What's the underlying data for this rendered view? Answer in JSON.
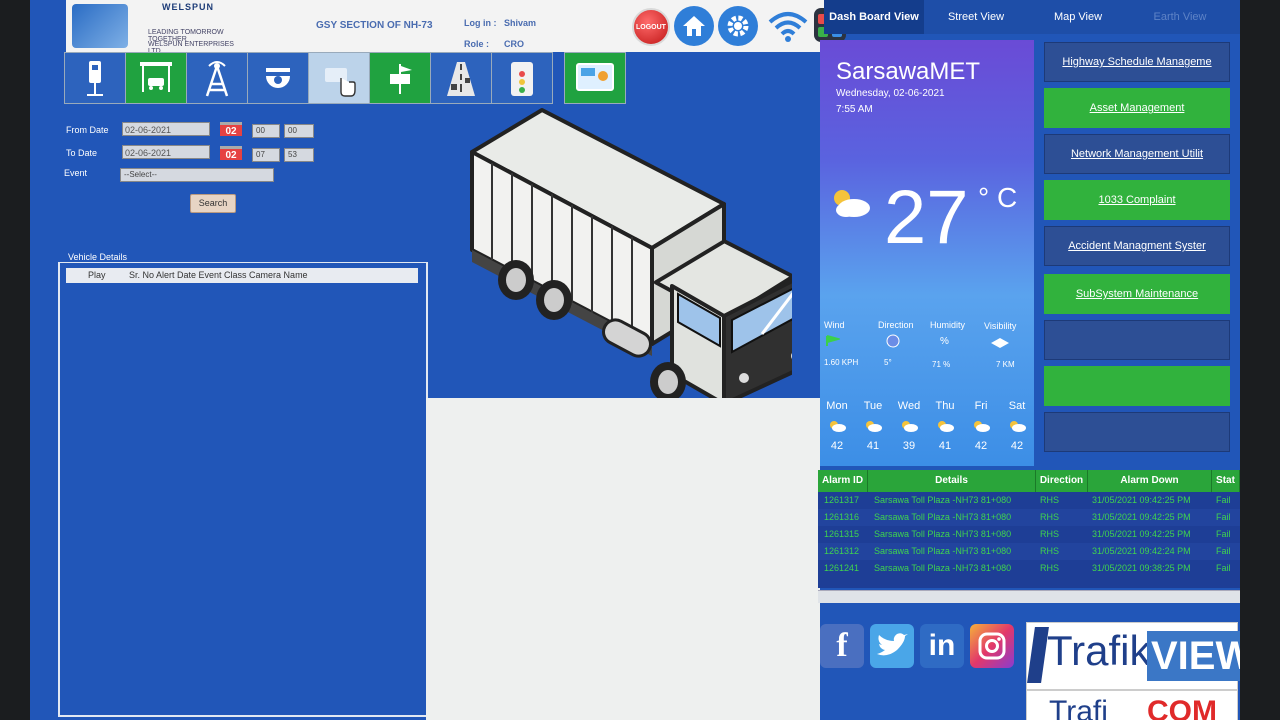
{
  "header": {
    "brand": "WELSPUN",
    "tagline": "LEADING TOMORROW TOGETHER",
    "company": "WELSPUN ENTERPRISES LTD.",
    "section": "GSY SECTION OF NH-73",
    "login_label": "Log in :",
    "login_value": "Shivam",
    "role_label": "Role :",
    "role_value": "CRO",
    "logout_label": "LOGOUT",
    "icons": [
      "home-icon",
      "gear-icon",
      "wifi-icon",
      "apps-icon"
    ]
  },
  "toolbar": {
    "items": [
      "kiosk-icon",
      "vehicle-icon",
      "tower-icon",
      "camera-icon",
      "hand-icon",
      "weather-station-icon",
      "road-icon",
      "meter-icon",
      "display-icon"
    ]
  },
  "filters": {
    "from_label": "From Date",
    "from_date": "02-06-2021",
    "from_cal": "02",
    "from_hour": "00",
    "from_min": "00",
    "to_label": "To Date",
    "to_date": "02-06-2021",
    "to_cal": "02",
    "to_hour": "07",
    "to_min": "53",
    "event_label": "Event",
    "event_value": "--Select--",
    "search_label": "Search"
  },
  "vehicle_details": {
    "title": "Vehicle Details",
    "col_play": "Play",
    "col_rest": "Sr. No Alert Date Event Class Camera Name"
  },
  "tabs": [
    "Dash Board View",
    "Street View",
    "Map View",
    "Earth View"
  ],
  "weather": {
    "city": "SarsawaMET",
    "date": "Wednesday, 02-06-2021",
    "time": "7:55 AM",
    "temp": "27",
    "unit": "° C",
    "wind_label": "Wind",
    "wind_value": "1.60 KPH",
    "direction_label": "Direction",
    "direction_value": "5°",
    "humidity_label": "Humidity",
    "humidity_value": "71 %",
    "visibility_label": "Visibility",
    "visibility_value": "7 KM",
    "forecast": [
      {
        "day": "Mon",
        "value": "42"
      },
      {
        "day": "Tue",
        "value": "41"
      },
      {
        "day": "Wed",
        "value": "39"
      },
      {
        "day": "Thu",
        "value": "41"
      },
      {
        "day": "Fri",
        "value": "42"
      },
      {
        "day": "Sat",
        "value": "42"
      }
    ]
  },
  "menu": [
    {
      "label": "Highway Schedule Manageme",
      "style": "dark"
    },
    {
      "label": "Asset Management",
      "style": "green"
    },
    {
      "label": "Network Management Utilit",
      "style": "dark"
    },
    {
      "label": "1033 Complaint",
      "style": "green"
    },
    {
      "label": "Accident Managment Syster",
      "style": "dark"
    },
    {
      "label": "SubSystem Maintenance",
      "style": "green"
    },
    {
      "label": "",
      "style": "dark"
    },
    {
      "label": "",
      "style": "green"
    },
    {
      "label": "",
      "style": "dark"
    }
  ],
  "alarms": {
    "headers": [
      "Alarm ID",
      "Details",
      "Direction",
      "Alarm Down",
      "Stat"
    ],
    "rows": [
      [
        "1261317",
        "Sarsawa Toll Plaza -NH73 81+080",
        "RHS",
        "31/05/2021 09:42:25 PM",
        "Fail"
      ],
      [
        "1261316",
        "Sarsawa Toll Plaza -NH73 81+080",
        "RHS",
        "31/05/2021 09:42:25 PM",
        "Fail"
      ],
      [
        "1261315",
        "Sarsawa Toll Plaza -NH73 81+080",
        "RHS",
        "31/05/2021 09:42:25 PM",
        "Fail"
      ],
      [
        "1261312",
        "Sarsawa Toll Plaza -NH73 81+080",
        "RHS",
        "31/05/2021 09:42:24 PM",
        "Fail"
      ],
      [
        "1261241",
        "Sarsawa Toll Plaza -NH73 81+080",
        "RHS",
        "31/05/2021 09:38:25 PM",
        "Fail"
      ]
    ]
  },
  "social": [
    "facebook-icon",
    "twitter-icon",
    "linkedin-icon",
    "instagram-icon"
  ],
  "trafikview": {
    "part1": "Trafik",
    "part2": "VIEW",
    "part3": "Trafi",
    "part4": "COM"
  },
  "colors": {
    "accent_blue": "#2156b8",
    "green": "#31b23d",
    "alarm_text": "#3fd34f"
  }
}
